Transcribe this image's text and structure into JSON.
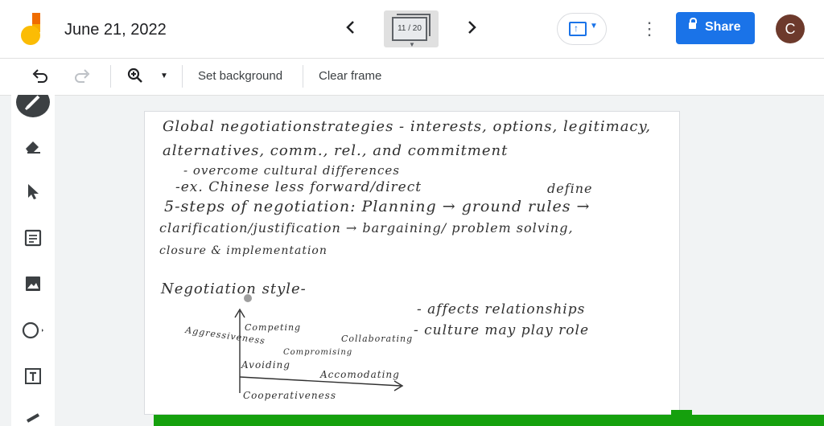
{
  "header": {
    "date": "June 21, 2022",
    "frame_indicator": "11 / 20",
    "share_label": "Share",
    "avatar_initial": "C",
    "colors": {
      "accent": "#1a73e8",
      "avatar": "#6d3a2c"
    },
    "icons": {
      "prev": "chevron-left-icon",
      "next": "chevron-right-icon",
      "present": "present-icon",
      "more": "more-vert-icon",
      "lock": "lock-icon"
    }
  },
  "toolbar": {
    "set_background": "Set background",
    "clear_frame": "Clear frame",
    "icons": [
      "undo-icon",
      "redo-icon",
      "zoom-icon",
      "zoom-dropdown-icon"
    ]
  },
  "sidebar": {
    "tools": [
      "pen-icon",
      "eraser-icon",
      "select-icon",
      "sticky-note-icon",
      "image-icon",
      "circle-icon",
      "text-box-icon",
      "laser-icon"
    ]
  },
  "canvas": {
    "lines": [
      "Global negotiationstrategies - interests, options, legitimacy,",
      "alternatives, comm., rel., and commitment",
      "- overcome cultural differences",
      "-ex. Chinese less forward/direct",
      "5-steps of negotiation: Planning → ground rules →",
      "define",
      "clarification/justification → bargaining/ problem solving,",
      "closure & implementation",
      "Negotiation style-",
      "- affects relationships",
      "- culture may play role",
      "Aggressiveness",
      "Competing",
      "Collaborating",
      "Compromising",
      "Avoiding",
      "Accomodating",
      "Cooperativeness"
    ]
  },
  "status_color": "#15a00d"
}
